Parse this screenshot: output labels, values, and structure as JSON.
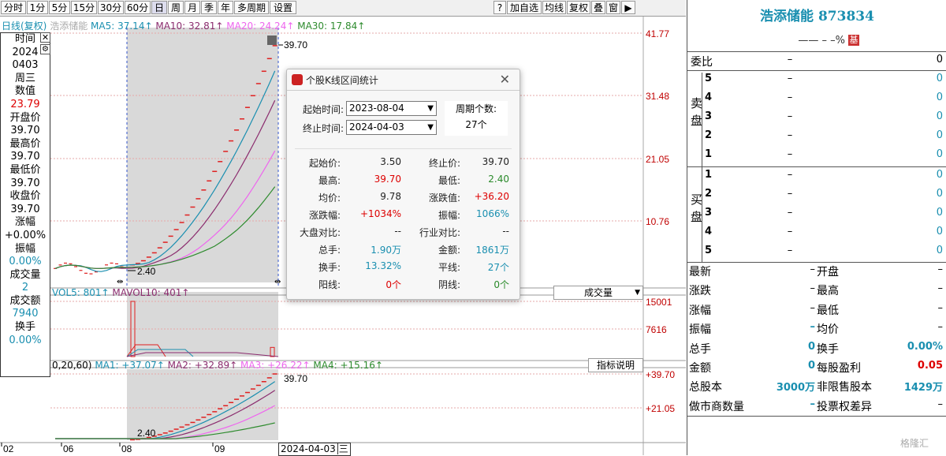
{
  "toolbar": {
    "periods": [
      "分时",
      "1分",
      "5分",
      "15分",
      "30分",
      "60分",
      "日",
      "周",
      "月",
      "季",
      "年",
      "多周期",
      "设置"
    ],
    "active_period": "日",
    "right_buttons": [
      "?",
      "加自选",
      "均线",
      "复权",
      "叠",
      "窗"
    ]
  },
  "main_chart": {
    "legend_name": "日线(复权)",
    "legend_stock": "浩添储能",
    "ma5": "MA5: 37.14↑",
    "ma10": "MA10: 32.81↑",
    "ma20": "MA20: 24.24↑",
    "ma30": "MA30: 17.84↑",
    "ma_colors": {
      "ma5": "#1a8fb0",
      "ma10": "#8b2c6e",
      "ma20": "#ee66ee",
      "ma30": "#2e8b2e"
    },
    "price_axis": [
      "41.77",
      "31.48",
      "21.05",
      "10.76"
    ],
    "high_label": "39.70",
    "low_label": "2.40"
  },
  "volume_chart": {
    "vol5": "VOL5: 801↑",
    "mavol10": "MAVOL10: 401↑",
    "axis": [
      "15001",
      "7616"
    ],
    "selector": "成交量"
  },
  "indicator_chart": {
    "params": "0,20,60)",
    "ma1": "MA1: +37.07↑",
    "ma2": "MA2: +32.89↑",
    "ma3": "MA3: +26.22↑",
    "ma4": "MA4: +15.16↑",
    "axis": [
      "+39.70",
      "+21.05"
    ],
    "button": "指标说明",
    "high_label": "39.70",
    "low_label": "2.40"
  },
  "date_axis": [
    "02",
    "06",
    "08",
    "09"
  ],
  "date_cursor": "2024-04-03",
  "date_cursor_day": "三",
  "info_column": [
    {
      "k": "时间",
      "v": "2024",
      "c": "v"
    },
    {
      "k": "",
      "v": "0403",
      "c": "v"
    },
    {
      "k": "",
      "v": "周三",
      "c": "v"
    },
    {
      "k": "数值",
      "v": "23.79",
      "c": "red"
    },
    {
      "k": "开盘价",
      "v": "39.70",
      "c": "v"
    },
    {
      "k": "最高价",
      "v": "39.70",
      "c": "v"
    },
    {
      "k": "最低价",
      "v": "39.70",
      "c": "v"
    },
    {
      "k": "收盘价",
      "v": "39.70",
      "c": "v"
    },
    {
      "k": "涨幅",
      "v": "+0.00%",
      "c": "v"
    },
    {
      "k": "振幅",
      "v": "0.00%",
      "c": "teal"
    },
    {
      "k": "成交量",
      "v": "2",
      "c": "teal"
    },
    {
      "k": "成交额",
      "v": "7940",
      "c": "teal"
    },
    {
      "k": "换手",
      "v": "0.00%",
      "c": "teal"
    }
  ],
  "dialog": {
    "title": "个股K线区间统计",
    "start_label": "起始时间:",
    "start_value": "2023-08-04",
    "end_label": "终止时间:",
    "end_value": "2024-04-03",
    "period_label": "周期个数:",
    "period_value": "27个",
    "stats": [
      {
        "l1": "起始价:",
        "v1": "3.50",
        "c1": "#222",
        "l2": "终止价:",
        "v2": "39.70",
        "c2": "#222"
      },
      {
        "l1": "最高:",
        "v1": "39.70",
        "c1": "#d00",
        "l2": "最低:",
        "v2": "2.40",
        "c2": "#2a8a2a"
      },
      {
        "l1": "均价:",
        "v1": "9.78",
        "c1": "#222",
        "l2": "涨跌值:",
        "v2": "+36.20",
        "c2": "#d00"
      },
      {
        "l1": "涨跌幅:",
        "v1": "+1034%",
        "c1": "#d00",
        "l2": "振幅:",
        "v2": "1066%",
        "c2": "#1a8fb0"
      },
      {
        "l1": "大盘对比:",
        "v1": "--",
        "c1": "#222",
        "l2": "行业对比:",
        "v2": "--",
        "c2": "#222"
      },
      {
        "l1": "总手:",
        "v1": "1.90万",
        "c1": "#1a8fb0",
        "l2": "金额:",
        "v2": "1861万",
        "c2": "#1a8fb0"
      },
      {
        "l1": "换手:",
        "v1": "13.32%",
        "c1": "#1a8fb0",
        "l2": "平线:",
        "v2": "27个",
        "c2": "#1a8fb0"
      },
      {
        "l1": "阳线:",
        "v1": "0个",
        "c1": "#d00",
        "l2": "阴线:",
        "v2": "0个",
        "c2": "#2a8a2a"
      }
    ]
  },
  "right_panel": {
    "stock_name": "浩添储能 873834",
    "sub_line": "—— – –%",
    "badge": "基",
    "weibi_label": "委比",
    "weibi_dash": "–",
    "weibi_value": "0",
    "sell_label": "卖盘",
    "buy_label": "买盘",
    "sell_rows": [
      {
        "n": "5",
        "p": "–",
        "v": "0"
      },
      {
        "n": "4",
        "p": "–",
        "v": "0"
      },
      {
        "n": "3",
        "p": "–",
        "v": "0"
      },
      {
        "n": "2",
        "p": "–",
        "v": "0"
      },
      {
        "n": "1",
        "p": "–",
        "v": "0"
      }
    ],
    "buy_rows": [
      {
        "n": "1",
        "p": "–",
        "v": "0"
      },
      {
        "n": "2",
        "p": "–",
        "v": "0"
      },
      {
        "n": "3",
        "p": "–",
        "v": "0"
      },
      {
        "n": "4",
        "p": "–",
        "v": "0"
      },
      {
        "n": "5",
        "p": "–",
        "v": "0"
      }
    ],
    "quote_rows": [
      {
        "l1": "最新",
        "v1": "–",
        "l2": "开盘",
        "v2": "–",
        "c1": "",
        "c2": ""
      },
      {
        "l1": "涨跌",
        "v1": "–",
        "l2": "最高",
        "v2": "–",
        "c1": "",
        "c2": ""
      },
      {
        "l1": "涨幅",
        "v1": "–",
        "l2": "最低",
        "v2": "–",
        "c1": "",
        "c2": ""
      },
      {
        "l1": "振幅",
        "v1": "–",
        "l2": "均价",
        "v2": "–",
        "c1": "teal",
        "c2": ""
      },
      {
        "l1": "总手",
        "v1": "0",
        "l2": "换手",
        "v2": "0.00%",
        "c1": "teal",
        "c2": "teal"
      },
      {
        "l1": "金额",
        "v1": "0",
        "l2": "每股盈利",
        "v2": "0.05",
        "c1": "teal",
        "c2": "red"
      },
      {
        "l1": "总股本",
        "v1": "3000万",
        "l2": "非限售股本",
        "v2": "1429万",
        "c1": "teal",
        "c2": "teal"
      },
      {
        "l1": "做市商数量",
        "v1": "–",
        "l2": "投票权差异",
        "v2": "–",
        "c1": "teal",
        "c2": ""
      }
    ],
    "watermark": "格隆汇"
  }
}
